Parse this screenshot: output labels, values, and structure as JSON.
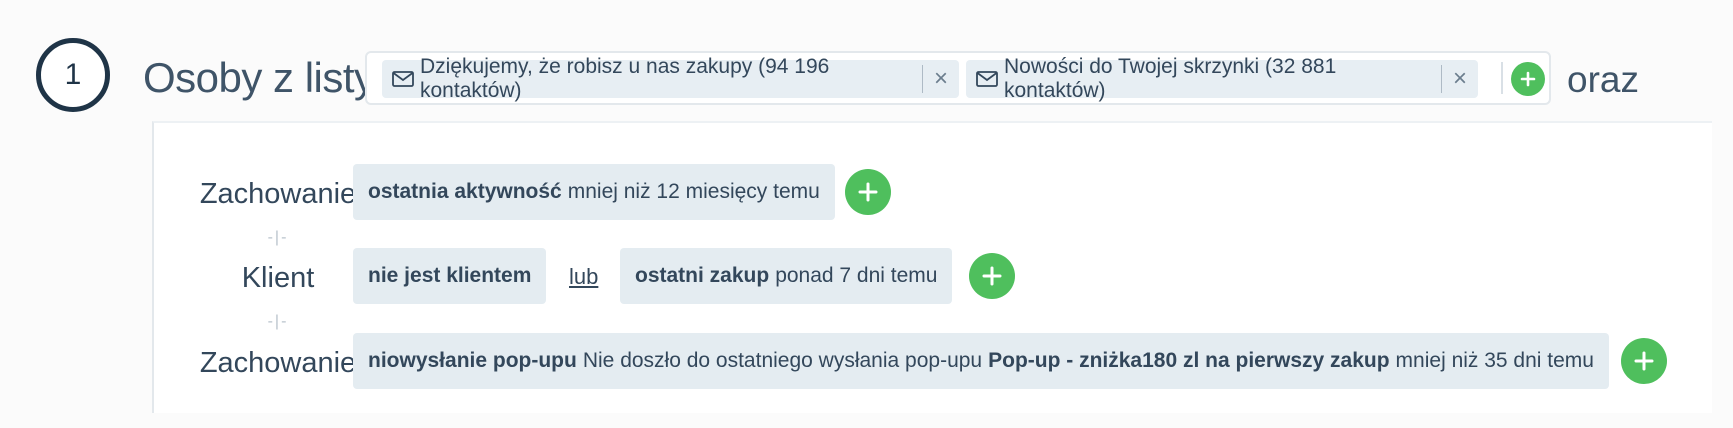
{
  "step": {
    "number": "1",
    "title": "Osoby z listy"
  },
  "lists": [
    {
      "label": "Dziękujemy, że robisz u nas zakupy (94 196 kontaktów)",
      "remove": "×"
    },
    {
      "label": "Nowości do Twojej skrzynki (32 881 kontaktów)",
      "remove": "×"
    }
  ],
  "connector": "oraz",
  "conditions": [
    {
      "label": "Zachowanie",
      "chips": [
        {
          "bold": "ostatnia aktywność",
          "text": "mniej niż 12 miesięcy temu"
        }
      ]
    },
    {
      "label": "Klient",
      "chips": [
        {
          "bold": "nie jest klientem"
        },
        {
          "bold": "ostatni zakup",
          "text": "ponad 7 dni temu"
        }
      ],
      "or": "lub"
    },
    {
      "label": "Zachowanie",
      "chips": [
        {
          "bold": "niowysłanie pop-upu",
          "text": "Nie doszło do ostatniego wysłania pop-upu",
          "bold2": "Pop-up - zniżka180 zl na pierwszy zakup",
          "text2": "mniej niż 35 dni temu"
        }
      ]
    }
  ],
  "separator": "-|-",
  "icons": {
    "list": "envelope-icon",
    "add": "plus-icon",
    "remove": "close-icon"
  },
  "colors": {
    "add_button": "#4fbf5d",
    "chip_bg": "#e4ecf1",
    "step_ring": "#1f3447"
  }
}
